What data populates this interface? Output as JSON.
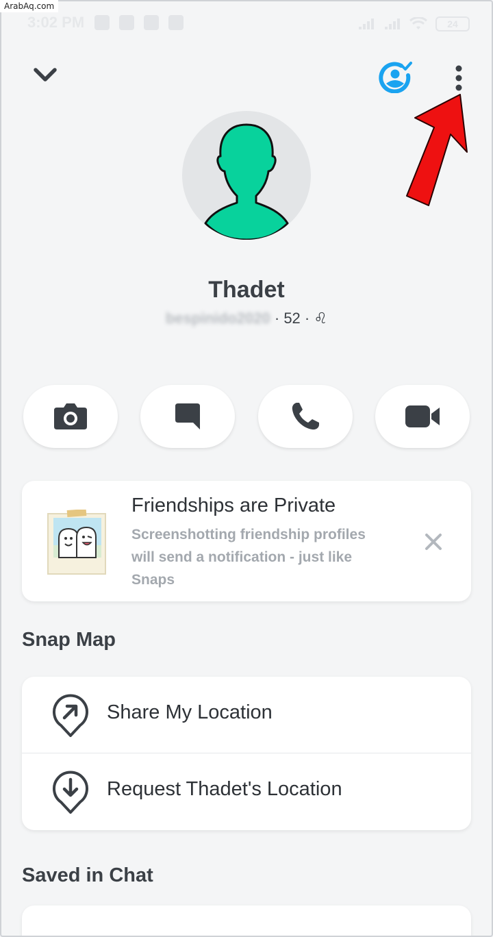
{
  "watermark": "ArabAq.com",
  "status_bar": {
    "time": "3:02 PM",
    "battery": "24"
  },
  "profile": {
    "display_name": "Thadet",
    "username": "bespinido2020",
    "separator": "·",
    "snap_score": "52",
    "zodiac_symbol": "♌"
  },
  "actions": [
    {
      "icon": "camera-icon"
    },
    {
      "icon": "chat-icon"
    },
    {
      "icon": "phone-icon"
    },
    {
      "icon": "video-icon"
    }
  ],
  "info_card": {
    "title": "Friendships are Private",
    "body": "Screenshotting friendship profiles will send a notification - just like Snaps"
  },
  "snap_map": {
    "title": "Snap Map",
    "items": [
      {
        "label": "Share My Location",
        "icon": "share-location-icon"
      },
      {
        "label": "Request Thadet's Location",
        "icon": "request-location-icon"
      }
    ]
  },
  "saved_in_chat": {
    "title": "Saved in Chat"
  },
  "colors": {
    "background": "#f4f5f6",
    "accent_blue": "#1aa3f0",
    "avatar_green": "#08d29c",
    "annotation_red": "#ee1111"
  }
}
